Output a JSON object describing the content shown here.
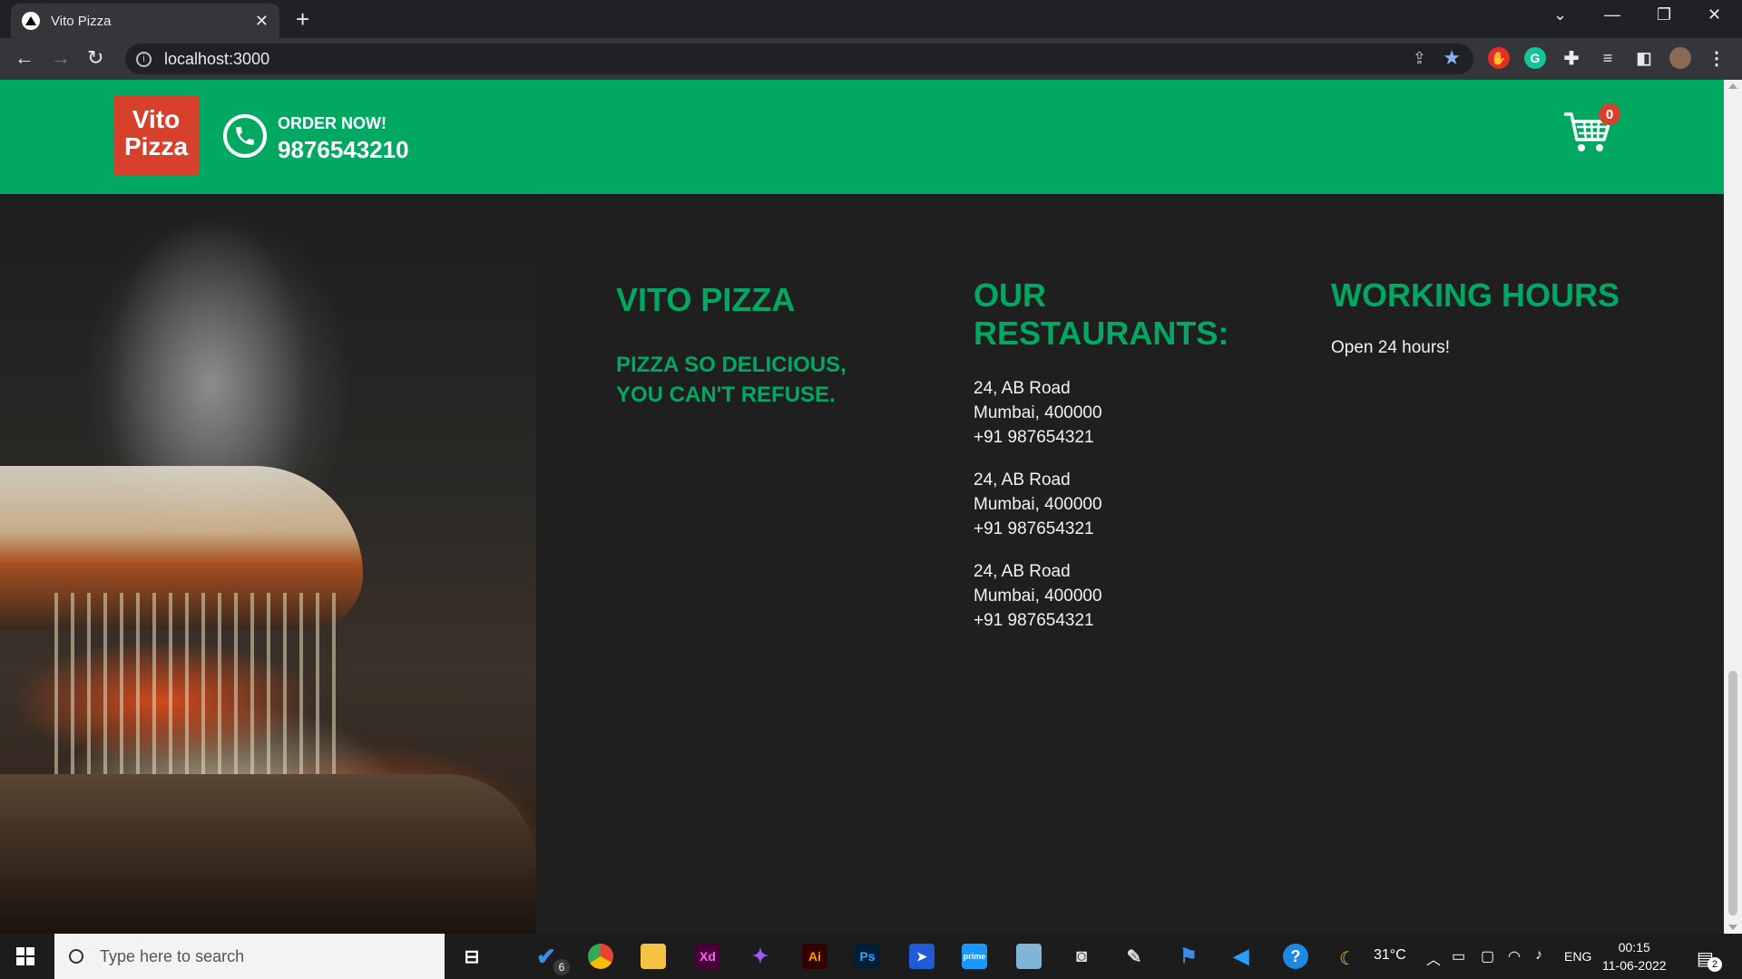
{
  "browser": {
    "tab_title": "Vito Pizza",
    "url": "localhost:3000",
    "new_tab": "+",
    "tab_close": "✕"
  },
  "site": {
    "logo_line1": "Vito",
    "logo_line2": "Pizza",
    "order_label": "ORDER NOW!",
    "order_phone": "9876543210",
    "cart_count": "0"
  },
  "footer": {
    "brand_title": "VITO PIZZA",
    "tagline": "PIZZA SO DELICIOUS, YOU CAN'T REFUSE.",
    "restaurants_title": "OUR RESTAURANTS:",
    "restaurants": [
      {
        "street": "24, AB Road",
        "city": "Mumbai, 400000",
        "phone": "+91 987654321"
      },
      {
        "street": "24, AB Road",
        "city": "Mumbai, 400000",
        "phone": "+91 987654321"
      },
      {
        "street": "24, AB Road",
        "city": "Mumbai, 400000",
        "phone": "+91 987654321"
      }
    ],
    "hours_title": "WORKING HOURS",
    "hours_text": "Open 24 hours!"
  },
  "taskbar": {
    "search_placeholder": "Type here to search",
    "todo_badge": "6",
    "weather": "31°C",
    "language": "ENG",
    "time": "00:15",
    "date": "11-06-2022",
    "notification_count": "2",
    "apps": [
      "task-view",
      "todo",
      "chrome",
      "file-explorer",
      "xd",
      "figma",
      "illustrator",
      "photoshop",
      "arrow-app",
      "prime-video",
      "notes",
      "camera",
      "paint",
      "framer",
      "vscode",
      "help"
    ]
  },
  "colors": {
    "brand_green": "#00a862",
    "logo_red": "#d7412c",
    "footer_bg": "#1f1f1f"
  }
}
